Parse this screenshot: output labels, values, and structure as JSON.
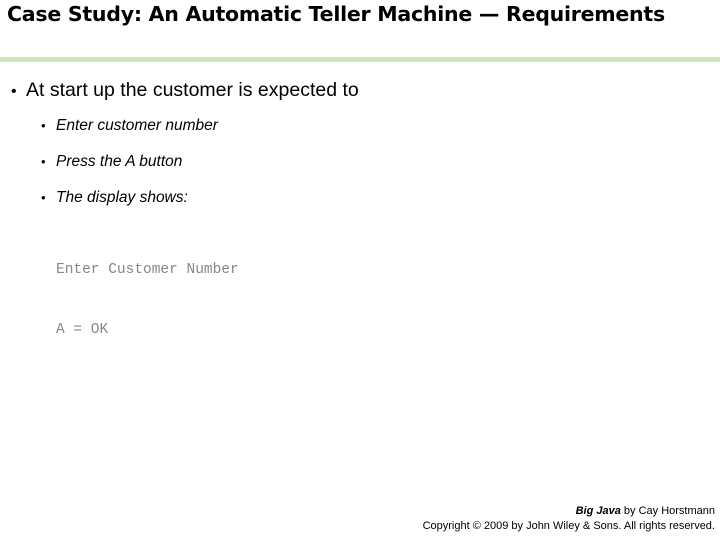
{
  "slide": {
    "title": "Case Study: An Automatic Teller Machine — Requirements",
    "accent_color": "#cce6b8",
    "background_color": "#ffffff",
    "text_color": "#000000",
    "code_color": "#878787"
  },
  "bullets": {
    "marker": "•",
    "level1": {
      "text": "At start up the customer is expected to"
    },
    "level2": [
      {
        "text": "Enter customer number"
      },
      {
        "text": "Press the A button"
      },
      {
        "text": "The display shows:"
      }
    ]
  },
  "code_display": {
    "lines": [
      "Enter Customer Number",
      "A = OK"
    ]
  },
  "footer": {
    "book_title": "Big Java",
    "byline": " by Cay Horstmann",
    "copyright": "Copyright © 2009 by John Wiley & Sons.  All rights reserved."
  }
}
